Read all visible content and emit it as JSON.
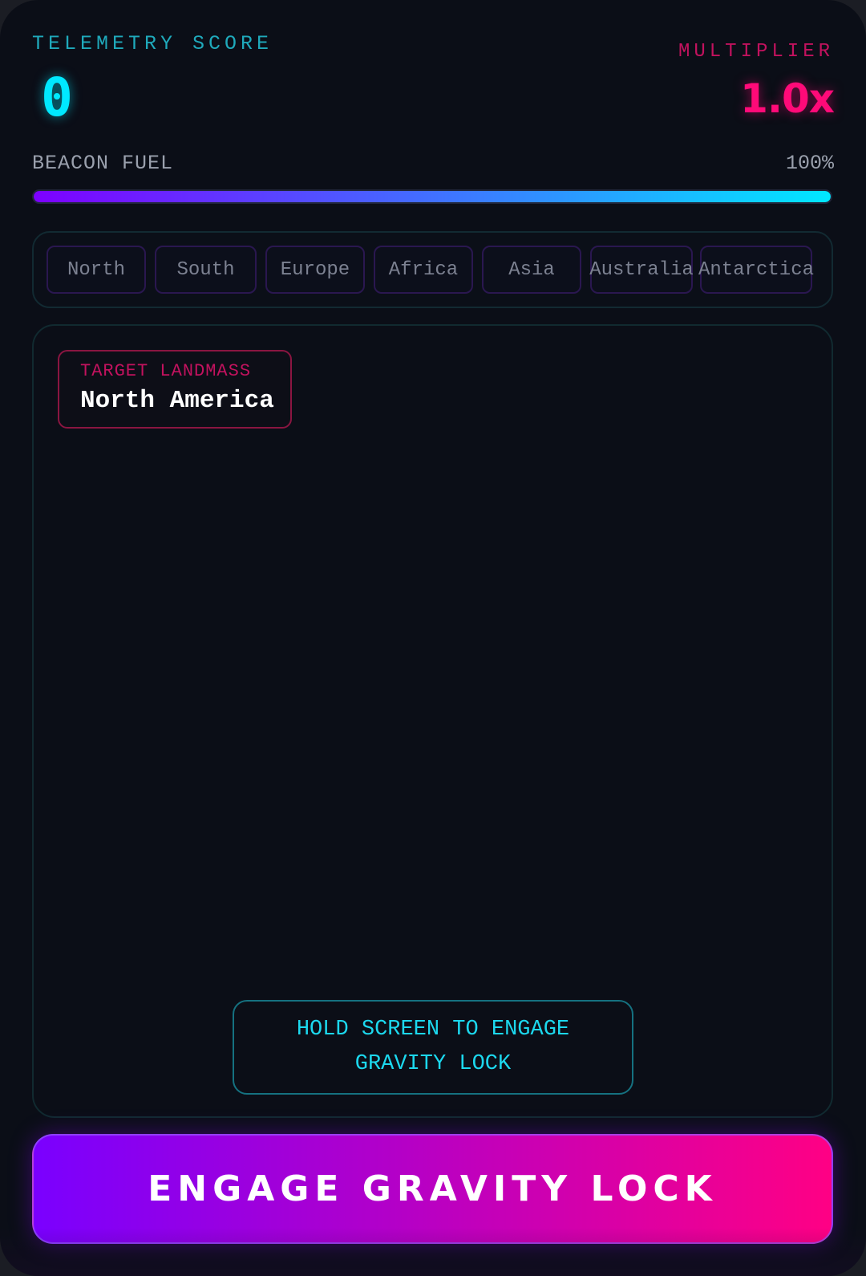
{
  "score": {
    "label": "TELEMETRY SCORE",
    "value": "0"
  },
  "multiplier": {
    "label": "MULTIPLIER",
    "value": "1.0x"
  },
  "fuel": {
    "label": "BEACON FUEL",
    "percent_text": "100%",
    "level_percent": 100
  },
  "continents": [
    {
      "label": "North"
    },
    {
      "label": "South"
    },
    {
      "label": "Europe"
    },
    {
      "label": "Africa"
    },
    {
      "label": "Asia"
    },
    {
      "label": "Australia"
    },
    {
      "label": "Antarctica"
    }
  ],
  "target": {
    "label": "TARGET LANDMASS",
    "name": "North America"
  },
  "hint": "HOLD SCREEN TO ENGAGE GRAVITY LOCK",
  "engage_button": "ENGAGE GRAVITY LOCK",
  "colors": {
    "cyan_accent": "#00e8ff",
    "magenta_accent": "#ff0a78",
    "purple_accent": "#7a00ff",
    "background": "#0b0e17"
  }
}
